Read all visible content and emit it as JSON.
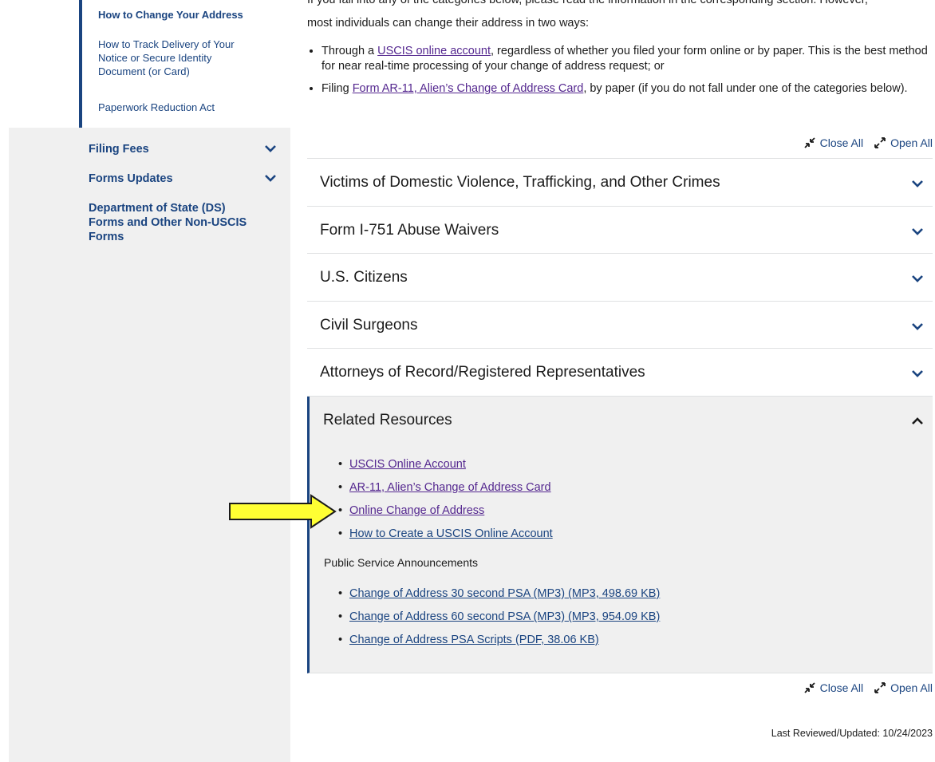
{
  "sidebar": {
    "sub_links": [
      "How to Change Your Address",
      "How to Track Delivery of Your Notice or Secure Identity Document (or Card)",
      "Paperwork Reduction Act"
    ],
    "nav_items": [
      {
        "label": "Filing Fees",
        "has_chevron": true
      },
      {
        "label": "Forms Updates",
        "has_chevron": true
      },
      {
        "label": "Department of State (DS) Forms and Other Non-USCIS Forms",
        "has_chevron": false
      }
    ]
  },
  "intro": {
    "clipped_line": "If you fall into any of the categories below, please read the information in the corresponding section. However,",
    "lead": "most individuals can change their address in two ways:",
    "bullet1_pre": "Through a ",
    "bullet1_link": "USCIS online account",
    "bullet1_post": ", regardless of whether you filed your form online or by paper. This is the best method for near real-time processing of your change of address request; or",
    "bullet2_pre": "Filing ",
    "bullet2_link": "Form AR-11, Alien’s Change of Address Card",
    "bullet2_post": ", by paper (if you do not fall under one of the categories below)."
  },
  "toggles": {
    "close_all": "Close All",
    "open_all": "Open All"
  },
  "accordion": [
    "Victims of Domestic Violence, Trafficking, and Other Crimes",
    "Form I-751 Abuse Waivers",
    "U.S. Citizens",
    "Civil Surgeons",
    "Attorneys of Record/Registered Representatives"
  ],
  "related": {
    "title": "Related Resources",
    "links": [
      {
        "label": "USCIS Online Account",
        "visited": true
      },
      {
        "label": "AR-11, Alien’s Change of Address Card",
        "visited": true
      },
      {
        "label": "Online Change of Address",
        "visited": true
      },
      {
        "label": "How to Create a USCIS Online Account",
        "visited": false
      }
    ],
    "psa_heading": "Public Service Announcements",
    "psa_links": [
      "Change of Address 30 second PSA (MP3) (MP3, 498.69 KB)",
      "Change of Address 60 second PSA (MP3) (MP3, 954.09 KB)",
      "Change of Address PSA Scripts (PDF, 38.06 KB)"
    ]
  },
  "updated": "Last Reviewed/Updated: 10/24/2023",
  "colors": {
    "link": "#1a4480",
    "visited": "#54278f",
    "arrow_fill": "#ffff33",
    "sidebar_bg": "#f0f0f0"
  }
}
